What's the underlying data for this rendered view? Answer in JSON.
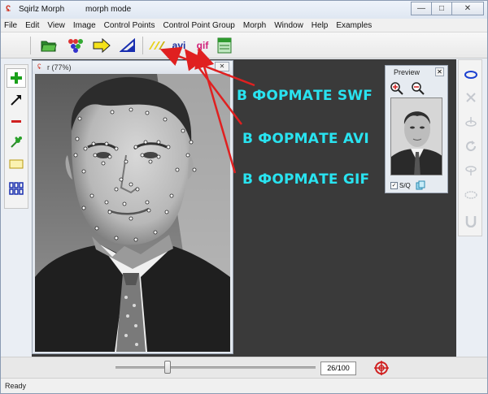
{
  "window": {
    "app_title": "Sqirlz Morph",
    "mode": "morph mode",
    "minimize": "—",
    "maximize": "□",
    "close": "✕"
  },
  "menu": {
    "items": [
      "File",
      "Edit",
      "View",
      "Image",
      "Control Points",
      "Control Point Group",
      "Morph",
      "Window",
      "Help",
      "Examples"
    ]
  },
  "toolbar": {
    "avi_label": "avi",
    "gif_label": "gif"
  },
  "image_window": {
    "title": "r  (77%)",
    "close": "✕"
  },
  "preview": {
    "title": "Preview",
    "close": "✕",
    "loop_label": "S/Q",
    "loop_checked": "✓"
  },
  "frame": {
    "display": "26/100",
    "slider_fraction": 0.26
  },
  "status": {
    "text": "Ready"
  },
  "annotations": {
    "swf": "В ФОРМАТЕ SWF",
    "avi": "В ФОРМАТЕ AVI",
    "gif": "В ФОРМАТЕ GIF",
    "color": "#29e3f0",
    "arrow_color": "#e02020"
  },
  "icons": {
    "open": "folder-icon",
    "control_points": "dots-icon",
    "morph": "arrow-right-icon",
    "warp": "triangle-icon",
    "swf": "swf-icon",
    "save_html": "page-icon"
  }
}
